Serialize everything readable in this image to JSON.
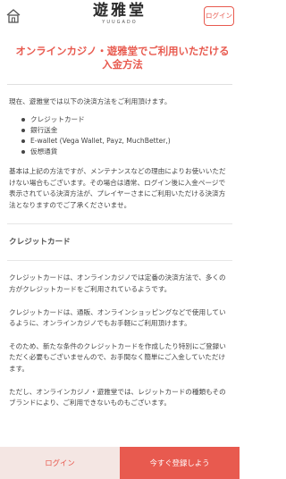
{
  "header": {
    "logo_jp": "遊雅堂",
    "logo_en": "YUUGADO",
    "login_label": "ログイン",
    "icons": {
      "home": "home-icon"
    }
  },
  "main": {
    "title": "オンラインカジノ・遊雅堂でご利用いただける入金方法",
    "intro": "現在、遊雅堂では以下の決済方法をご利用頂けます。",
    "methods": [
      "クレジットカード",
      "銀行送金",
      "E-wallet (Vega Wallet, Payz, MuchBetter,)",
      "仮想通貨"
    ],
    "note": "基本は上記の方法ですが、メンテナンスなどの理由によりお使いいただけない場合もございます。その場合は通常、ログイン後に入金ページで表示されている決済方法が、プレイヤーさまにご利用いただける決済方法となりますのでご了承くださいませ。",
    "section_title": "クレジットカード",
    "paragraphs": [
      "クレジットカードは、オンラインカジノでは定番の決済方法で、多くの方がクレジットカードをご利用されているようです。",
      "クレジットカードは、通販、オンラインショッピングなどで使用しているように、オンラインカジノでもお手軽にご利用頂けます。",
      "そのため、新たな条件のクレジットカードを作成したり特別にご登録いただく必要もございませんので、お手間なく簡単にご入金していただけます。",
      "ただし、オンラインカジノ・遊雅堂では、レジットカードの種類もそのブランドにより、ご利用できないものもございます。"
    ]
  },
  "bottom": {
    "login_label": "ログイン",
    "register_label": "今すぐ登録しよう"
  },
  "colors": {
    "accent": "#e85a4f",
    "login_bg": "#f4e6e3"
  }
}
